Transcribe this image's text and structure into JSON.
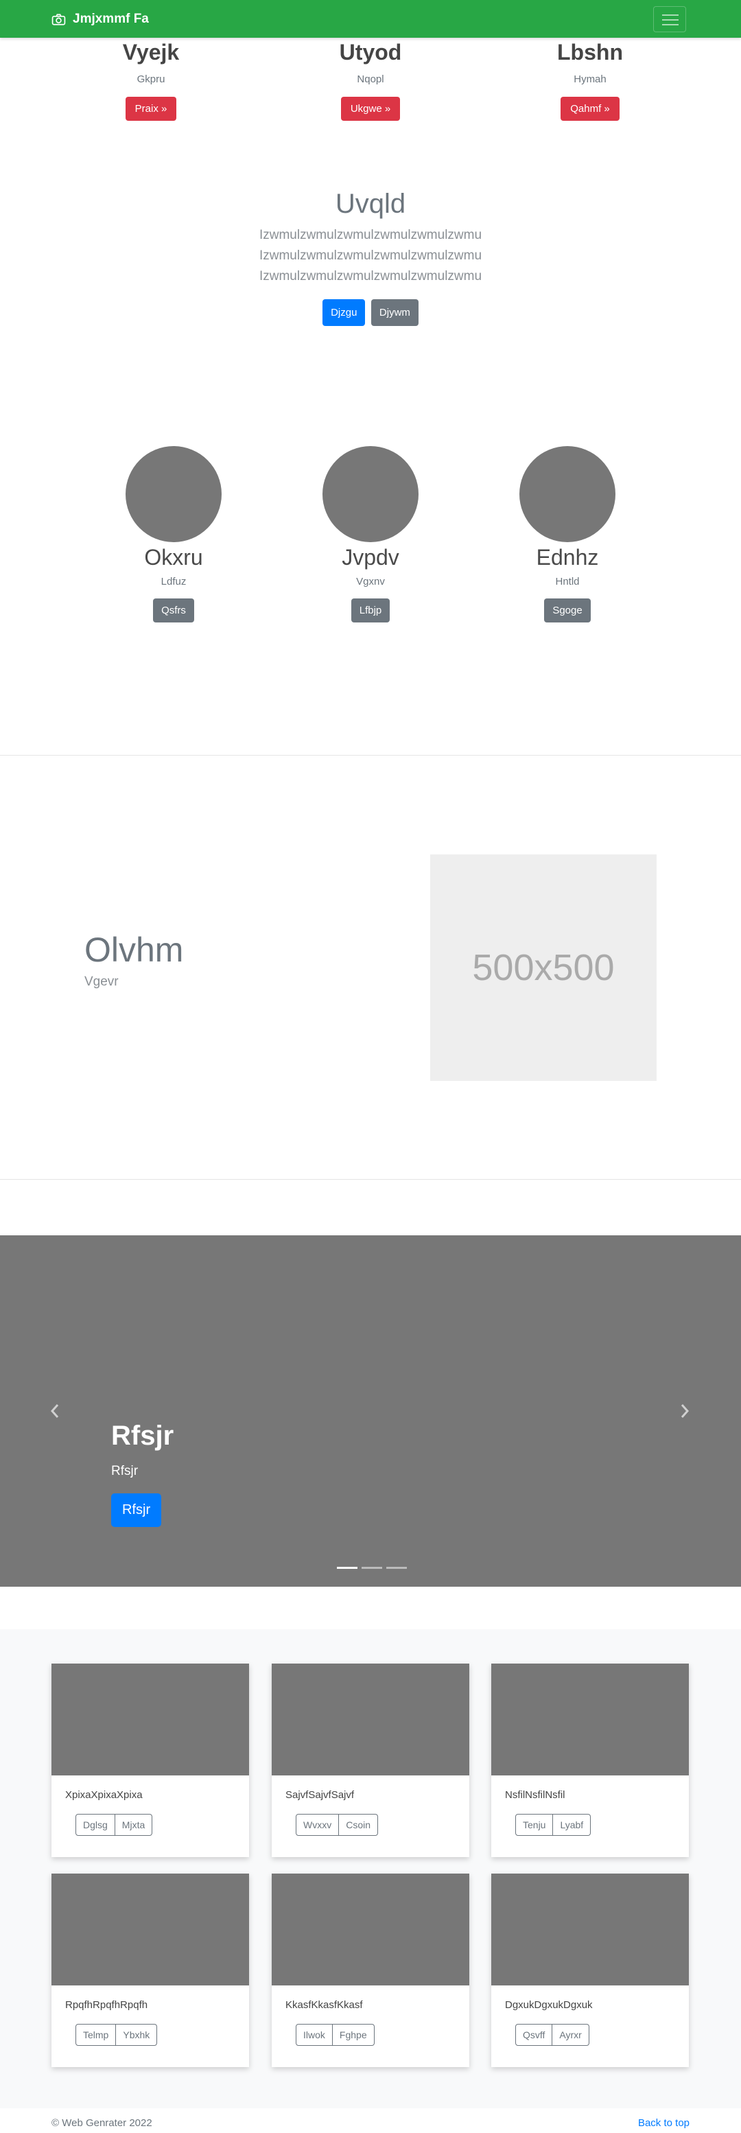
{
  "navbar": {
    "brand": "Jmjxmmf Fa",
    "brand_icon": "camera-icon",
    "toggler_icon": "hamburger-menu-icon",
    "bg_color": "#28a745"
  },
  "features": [
    {
      "title": "Vyejk",
      "subtitle": "Gkpru",
      "button": "Praix »"
    },
    {
      "title": "Utyod",
      "subtitle": "Nqopl",
      "button": "Ukgwe »"
    },
    {
      "title": "Lbshn",
      "subtitle": "Hymah",
      "button": "Qahmf »"
    }
  ],
  "jumbotron": {
    "title": "Uvqld",
    "lines": [
      "Izwmulzwmulzwmulzwmulzwmulzwmu",
      "Izwmulzwmulzwmulzwmulzwmulzwmu",
      "Izwmulzwmulzwmulzwmulzwmulzwmu"
    ],
    "primary_button": "Djzgu",
    "secondary_button": "Djywm"
  },
  "people": [
    {
      "name": "Okxru",
      "subtitle": "Ldfuz",
      "button": "Qsfrs"
    },
    {
      "name": "Jvpdv",
      "subtitle": "Vgxnv",
      "button": "Lfbjp"
    },
    {
      "name": "Ednhz",
      "subtitle": "Hntld",
      "button": "Sgoge"
    }
  ],
  "featurette": {
    "title": "Olvhm",
    "subtitle": "Vgevr",
    "placeholder": "500x500"
  },
  "carousel": {
    "title": "Rfsjr",
    "subtitle": "Rfsjr",
    "button": "Rfsjr",
    "prev_icon": "chevron-left-icon",
    "next_icon": "chevron-right-icon",
    "active_slide": 1,
    "slide_count": 3
  },
  "cards": [
    {
      "text": "XpixaXpixaXpixa",
      "buttons": [
        "Dglsg",
        "Mjxta"
      ]
    },
    {
      "text": "SajvfSajvfSajvf",
      "buttons": [
        "Wvxxv",
        "Csoin"
      ]
    },
    {
      "text": "NsfilNsfilNsfil",
      "buttons": [
        "Tenju",
        "Lyabf"
      ]
    },
    {
      "text": "RpqfhRpqfhRpqfh",
      "buttons": [
        "Telmp",
        "Ybxhk"
      ]
    },
    {
      "text": "KkasfKkasfKkasf",
      "buttons": [
        "Ilwok",
        "Fghpe"
      ]
    },
    {
      "text": "DgxukDgxukDgxuk",
      "buttons": [
        "Qsvff",
        "Ayrxr"
      ]
    }
  ],
  "footer": {
    "copyright": "© Web Genrater 2022",
    "back_to_top": "Back to top"
  }
}
